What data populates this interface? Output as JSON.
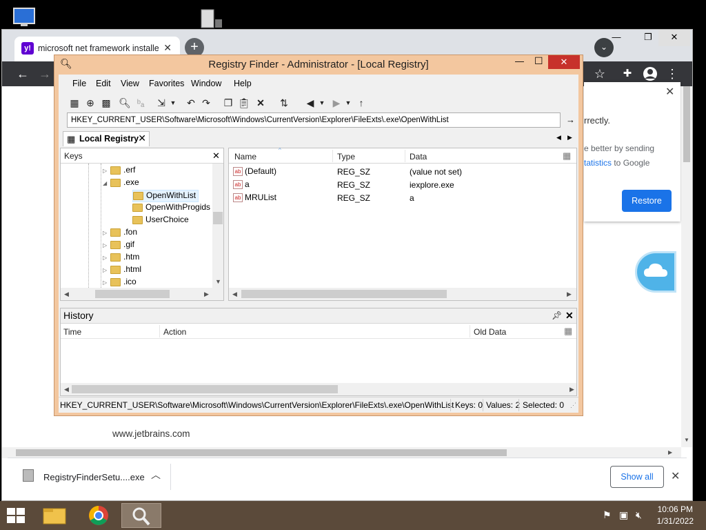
{
  "browser": {
    "tab_title": "microsoft net framework installer",
    "tab_favicon": "y!",
    "restore_card": {
      "text1": "rrectly.",
      "text2": "e better by sending",
      "text3_link": "tatistics",
      "text3_rest": " to Google",
      "restore_button": "Restore"
    },
    "page_text": "www.jetbrains.com",
    "download": {
      "file_name": "RegistryFinderSetu....exe",
      "show_all": "Show all"
    }
  },
  "registry_finder": {
    "window_title": "Registry Finder - Administrator - [Local Registry]",
    "menu": [
      "File",
      "Edit",
      "View",
      "Favorites",
      "Window",
      "Help"
    ],
    "path": "HKEY_CURRENT_USER\\Software\\Microsoft\\Windows\\CurrentVersion\\Explorer\\FileExts\\.exe\\OpenWithList",
    "doc_tab": "Local Registry",
    "keys_header": "Keys",
    "tree": [
      {
        "label": ".erf",
        "level": 0,
        "arrow": "▷"
      },
      {
        "label": ".exe",
        "level": 0,
        "arrow": "◢"
      },
      {
        "label": "OpenWithList",
        "level": 1,
        "arrow": ""
      },
      {
        "label": "OpenWithProgids",
        "level": 1,
        "arrow": ""
      },
      {
        "label": "UserChoice",
        "level": 1,
        "arrow": ""
      },
      {
        "label": ".fon",
        "level": 0,
        "arrow": "▷"
      },
      {
        "label": ".gif",
        "level": 0,
        "arrow": "▷"
      },
      {
        "label": ".htm",
        "level": 0,
        "arrow": "▷"
      },
      {
        "label": ".html",
        "level": 0,
        "arrow": "▷"
      },
      {
        "label": ".ico",
        "level": 0,
        "arrow": "▷"
      }
    ],
    "values_columns": {
      "name": "Name",
      "type": "Type",
      "data": "Data"
    },
    "values": [
      {
        "name": "(Default)",
        "type": "REG_SZ",
        "data": "(value not set)"
      },
      {
        "name": "a",
        "type": "REG_SZ",
        "data": "iexplore.exe"
      },
      {
        "name": "MRUList",
        "type": "REG_SZ",
        "data": "a"
      }
    ],
    "history": {
      "title": "History",
      "columns": {
        "time": "Time",
        "action": "Action",
        "old_data": "Old Data"
      }
    },
    "status": {
      "path": "HKEY_CURRENT_USER\\Software\\Microsoft\\Windows\\CurrentVersion\\Explorer\\FileExts\\.exe\\OpenWithList",
      "keys": "Keys: 0",
      "values": "Values: 2",
      "selected": "Selected: 0"
    }
  },
  "taskbar": {
    "time": "10:06 PM",
    "date": "1/31/2022"
  }
}
